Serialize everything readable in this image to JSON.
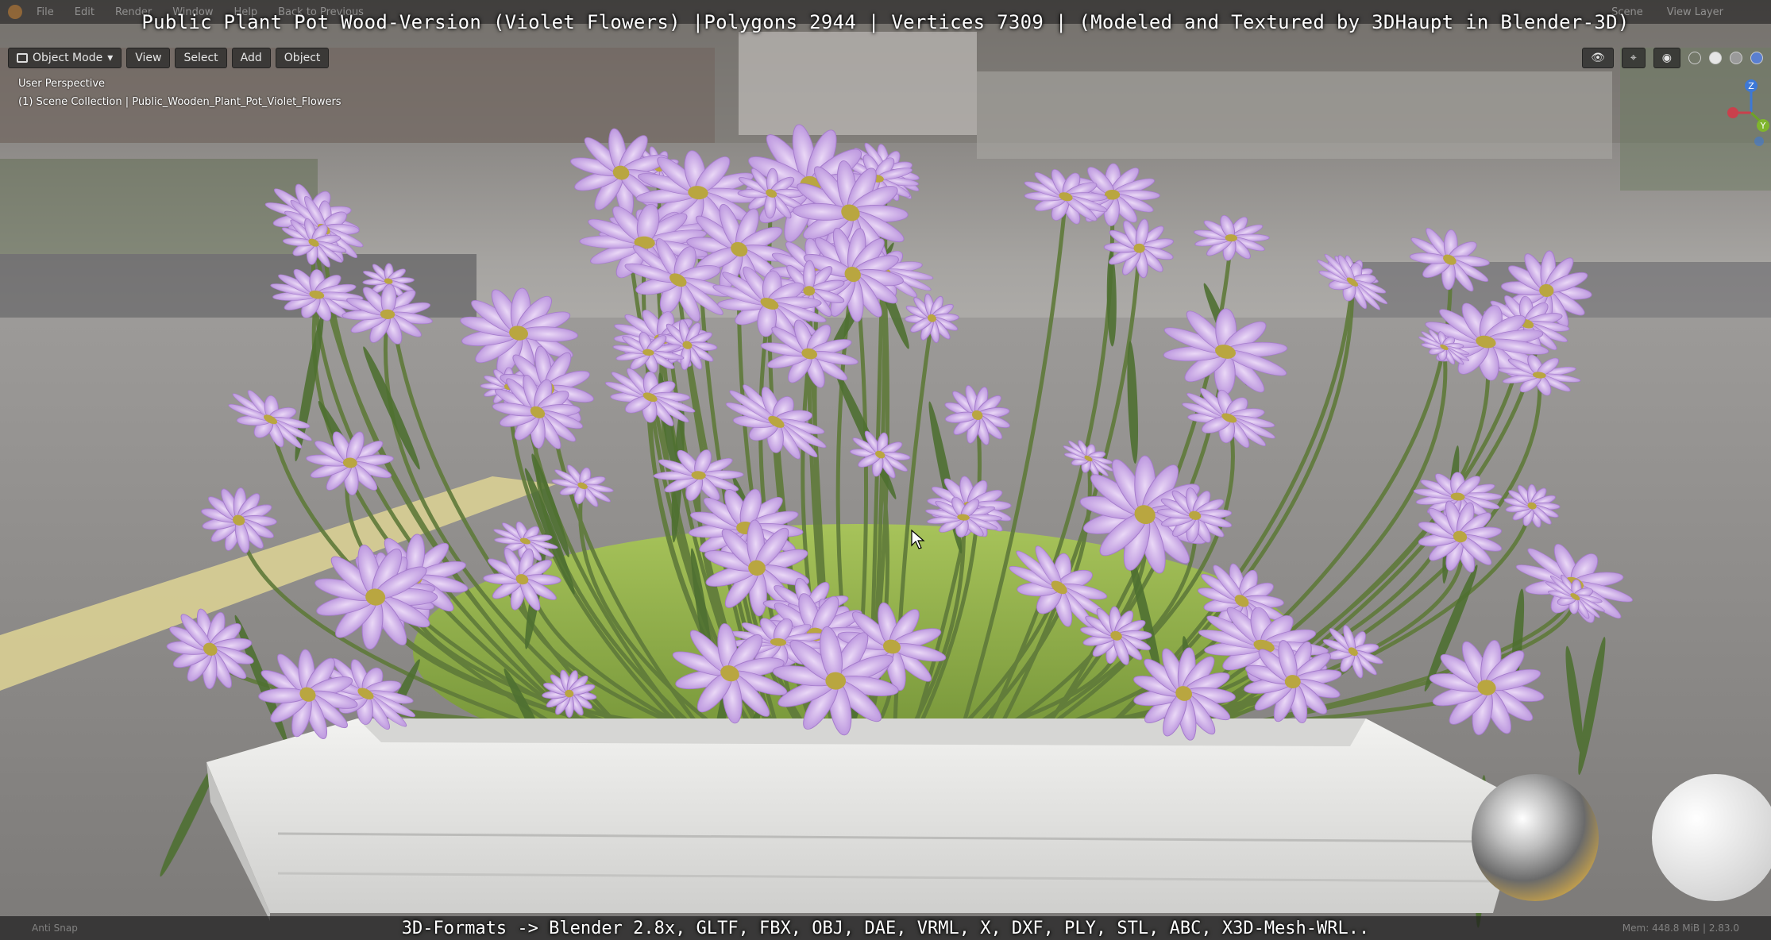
{
  "title_overlay": "Public Plant Pot Wood-Version (Violet Flowers) |Polygons 2944 | Vertices 7309 | (Modeled and Textured by 3DHaupt in Blender-3D)",
  "topbar": {
    "menus": [
      "File",
      "Edit",
      "Render",
      "Window",
      "Help"
    ],
    "back_to_previous": "Back to Previous",
    "scene_label": "Scene",
    "view_layer_label": "View Layer"
  },
  "header": {
    "mode": "Object Mode",
    "view": "View",
    "select": "Select",
    "add": "Add",
    "object": "Object"
  },
  "viewport": {
    "perspective": "User Perspective",
    "collection": "(1) Scene Collection | Public_Wooden_Plant_Pot_Violet_Flowers"
  },
  "gizmo": {
    "z_label": "Z",
    "y_label": "Y"
  },
  "footer": {
    "formats_overlay": "3D-Formats -> Blender 2.8x, GLTF, FBX, OBJ, DAE, VRML, X, DXF, PLY, STL, ABC, X3D-Mesh-WRL..",
    "left_status": "Anti Snap",
    "right_status": "Mem: 448.8 MiB | 2.83.0"
  },
  "colors": {
    "petal": "#c9a6e6",
    "petal_dark": "#a57ccb",
    "grass": "#8fb04a",
    "planter": "#e8e8e6"
  }
}
